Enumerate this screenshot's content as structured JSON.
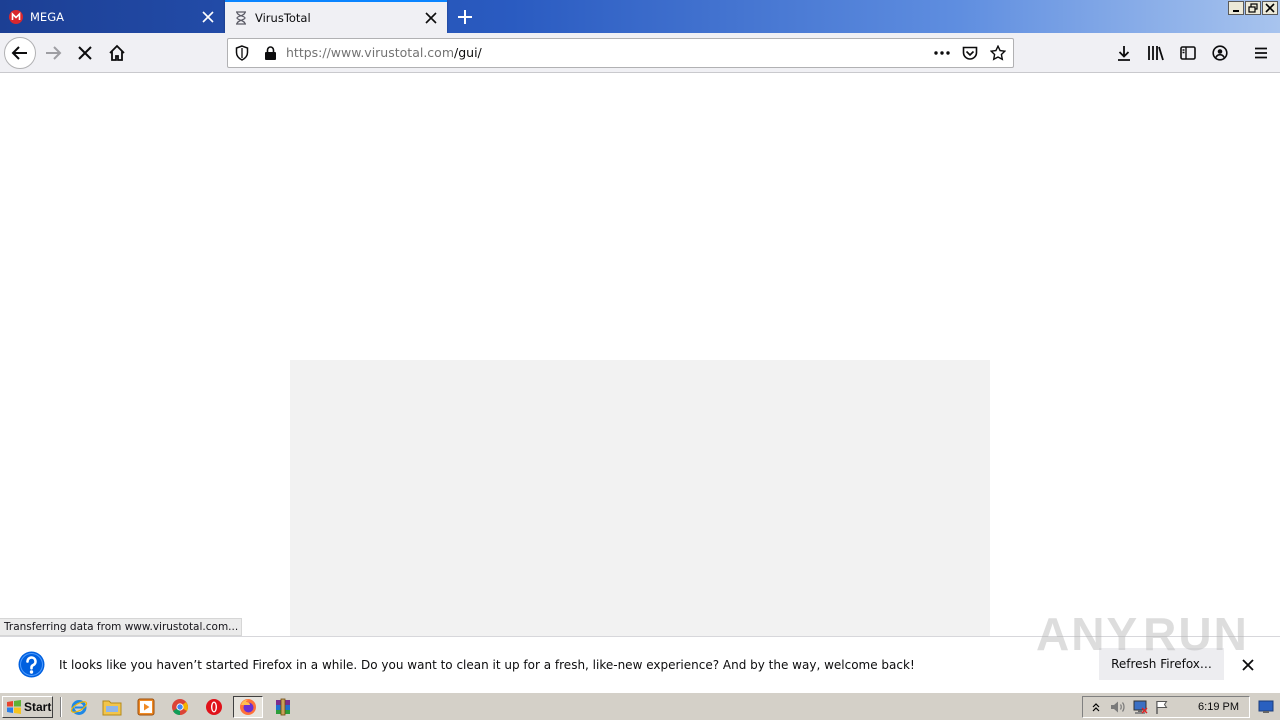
{
  "tabs": [
    {
      "title": "MEGA",
      "icon": "mega-logo-icon",
      "active": false
    },
    {
      "title": "VirusTotal",
      "icon": "hourglass-loading-icon",
      "active": true
    }
  ],
  "navbar": {
    "url_host": "https://www.virustotal.com",
    "url_path": "/gui/"
  },
  "status_bar": {
    "text": "Transferring data from www.virustotal.com..."
  },
  "notification": {
    "message": "It looks like you haven’t started Firefox in a while. Do you want to clean it up for a fresh, like-new experience? And by the way, welcome back!",
    "button_label": "Refresh Firefox…"
  },
  "watermark": {
    "left": "ANY",
    "right": "RUN"
  },
  "taskbar": {
    "start_label": "Start",
    "clock": "6:19 PM"
  },
  "colors": {
    "accent": "#0a84ff",
    "notification_icon": "#0060df",
    "mega_red": "#d9272e"
  }
}
